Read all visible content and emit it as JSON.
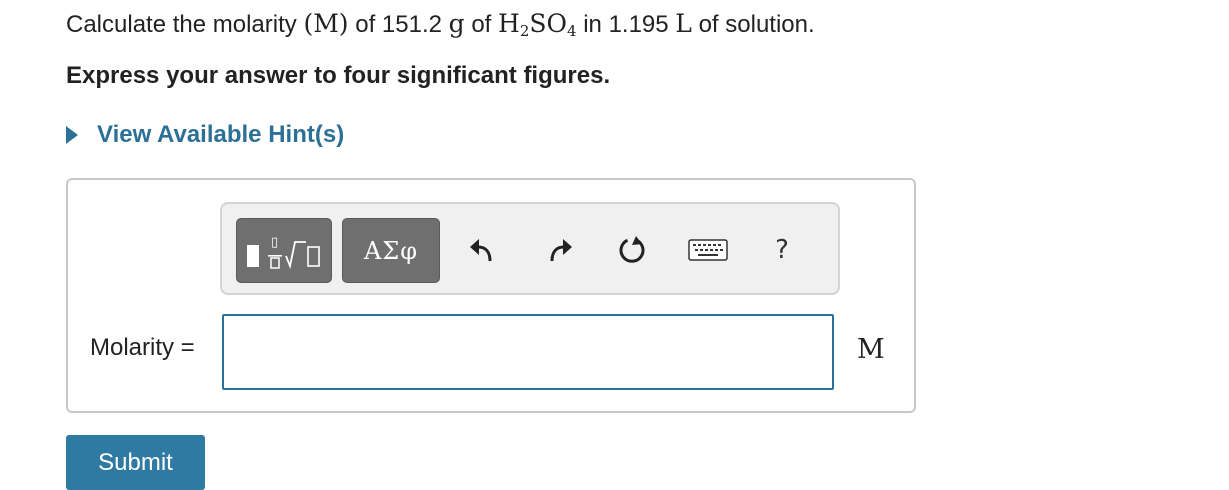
{
  "question": {
    "prefix": "Calculate the molarity ",
    "molarity_symbol": "(M)",
    "of_text_1": " of ",
    "mass_value": "151.2",
    "mass_unit": "g",
    "of_text_2": " of ",
    "formula_h": "H",
    "formula_h_subscript": "2",
    "formula_so": "SO",
    "formula_o_subscript": "4",
    "in_text": " in ",
    "volume_value": "1.195",
    "volume_unit": "L",
    "suffix": " of solution."
  },
  "instruction": "Express your answer to four significant figures.",
  "hint_toggle": {
    "label": "View Available Hint(s)",
    "icon": "caret-right-icon"
  },
  "toolbar": {
    "templates_icon": "templates-icon",
    "symbols_label": "ΑΣφ",
    "undo_icon": "undo-icon",
    "redo_icon": "redo-icon",
    "reset_icon": "reset-icon",
    "keyboard_icon": "keyboard-icon",
    "help_label": "?"
  },
  "answer": {
    "label": "Molarity =",
    "value": "",
    "placeholder": "",
    "unit": "M"
  },
  "submit_label": "Submit",
  "colors": {
    "link": "#2d7096",
    "submit_bg": "#2f7aa3",
    "toolbar_button_bg": "#6f6f6f",
    "toolbar_bg": "#f0f0f0",
    "input_border": "#2d7096",
    "panel_border": "#c8c8c8"
  }
}
